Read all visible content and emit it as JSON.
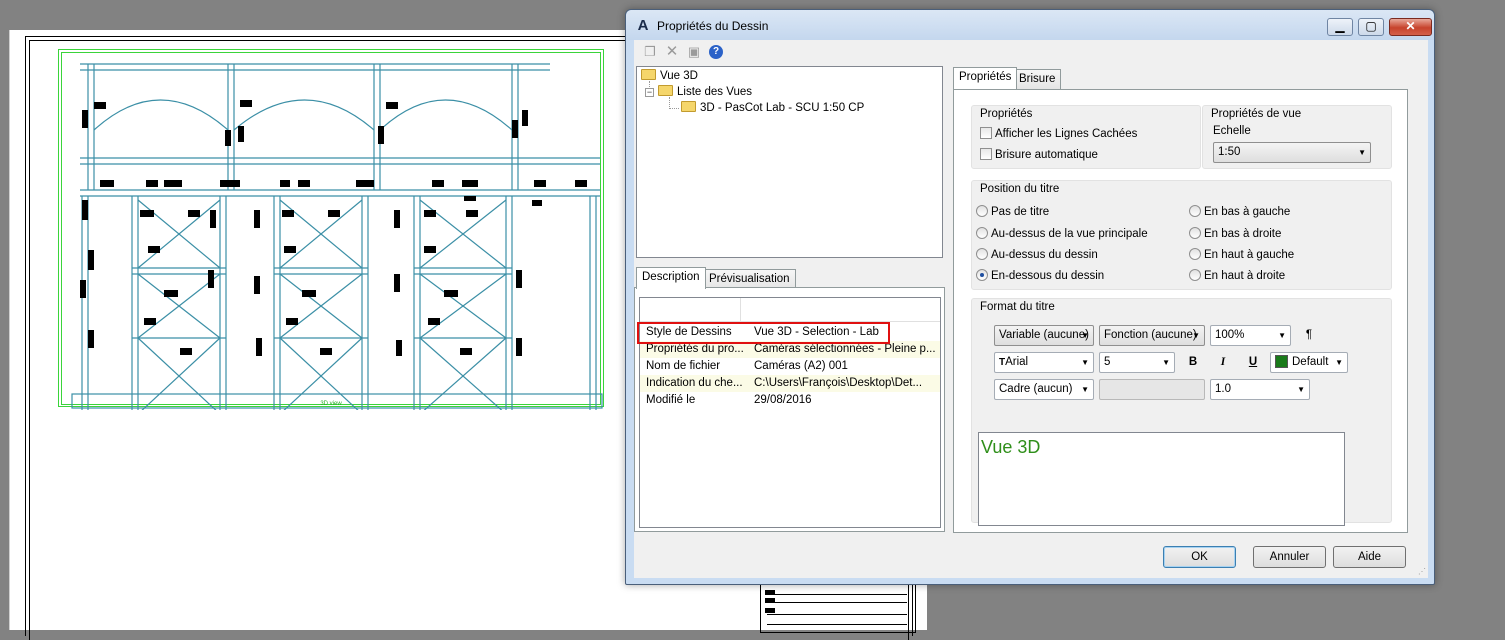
{
  "background": {
    "view_label": "3D view"
  },
  "dialog": {
    "title": "Propriétés du Dessin",
    "window_buttons": {
      "minimize": "▁",
      "maximize": "▢",
      "close": "✕"
    },
    "toolbar_icons": [
      "copy-icon",
      "delete-icon",
      "save-icon",
      "help-icon"
    ],
    "tree": {
      "root": "Vue 3D",
      "list": "Liste des Vues",
      "view_item": "3D - PasCot Lab - SCU 1:50  CP"
    },
    "left_tabs": [
      "Description",
      "Prévisualisation"
    ],
    "description_rows": [
      {
        "name": "Style de Dessins",
        "value": "Vue 3D - Selection - Lab"
      },
      {
        "name": "Propriétés du pro...",
        "value": "Caméras sélectionnées - Pleine p..."
      },
      {
        "name": "Nom de fichier",
        "value": "Caméras (A2) 001"
      },
      {
        "name": "Indication du che...",
        "value": "C:\\Users\\François\\Desktop\\Det..."
      },
      {
        "name": "Modifié le",
        "value": "29/08/2016"
      }
    ],
    "right_tabs": [
      "Propriétés",
      "Brisure"
    ],
    "props_group": {
      "label": "Propriétés",
      "hidden_lines": "Afficher les Lignes Cachées",
      "auto_break": "Brisure automatique"
    },
    "view_props": {
      "label": "Propriétés de vue",
      "scale_label": "Echelle",
      "scale_value": "1:50"
    },
    "title_position": {
      "label": "Position du titre",
      "options": [
        "Pas de titre",
        "Au-dessus de la vue principale",
        "Au-dessus du dessin",
        "En-dessous du dessin",
        "En bas à gauche",
        "En bas à droite",
        "En haut à gauche",
        "En haut à droite"
      ],
      "selected": "En-dessous du dessin"
    },
    "title_format": {
      "label": "Format du titre",
      "variable": "Variable (aucune)",
      "function": "Fonction (aucune)",
      "zoom": "100%",
      "paragraph_icon": "¶",
      "font": "Arial",
      "size": "5",
      "bold": "B",
      "italic": "I",
      "underline": "U",
      "color": "Default",
      "color_hex": "#1a7a1a",
      "frame": "Cadre (aucun)",
      "frame_extra": "",
      "ratio": "1.0",
      "preview_text": "Vue 3D",
      "preview_color": "#2f8f1a"
    },
    "buttons": {
      "ok": "OK",
      "cancel": "Annuler",
      "help": "Aide"
    }
  }
}
